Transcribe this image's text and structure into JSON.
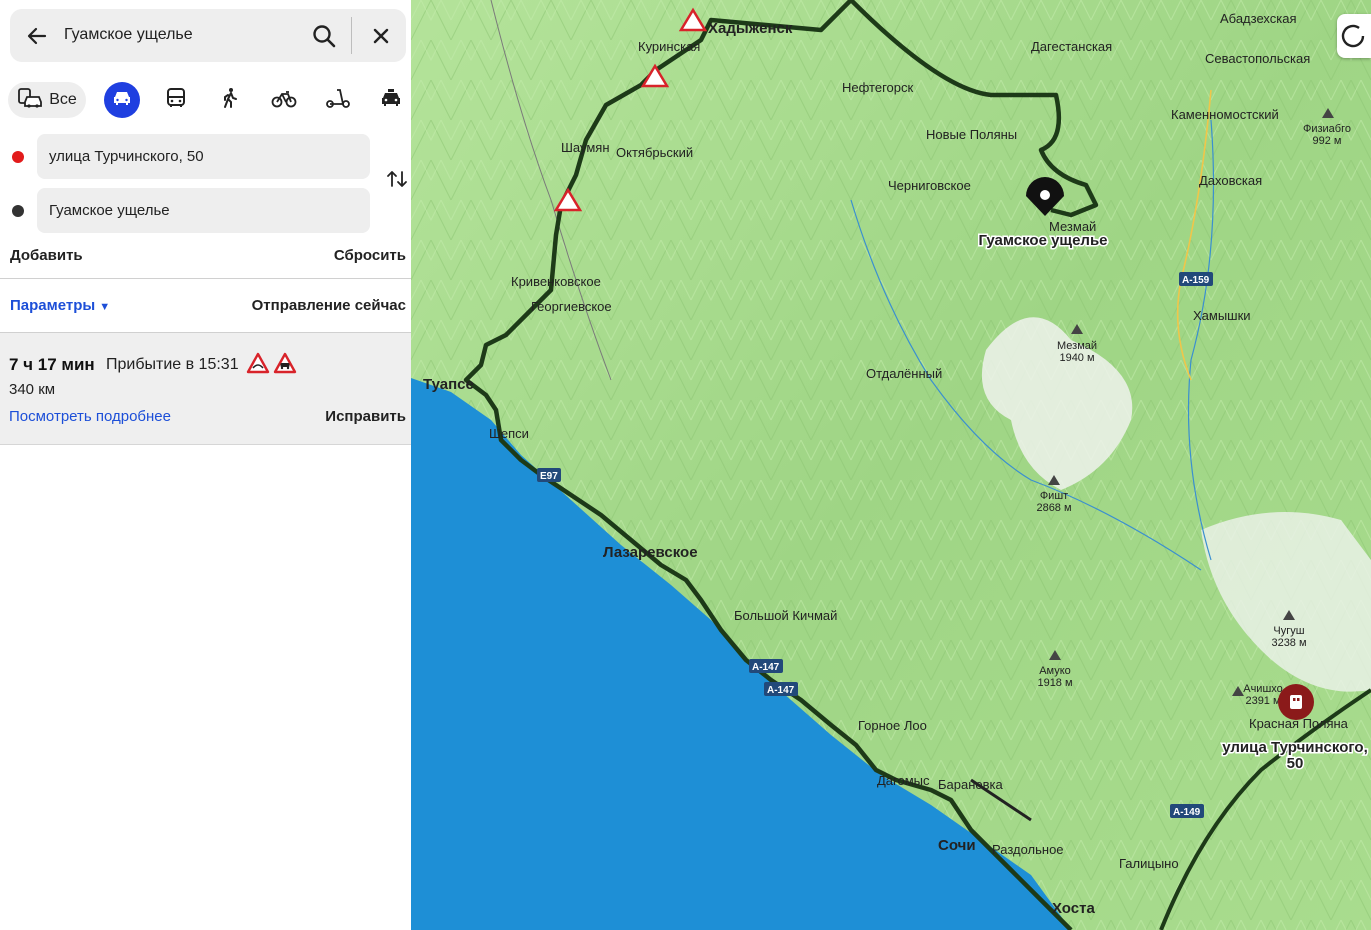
{
  "search": {
    "query": "Гуамское ущелье",
    "back_icon": "arrow-left-icon",
    "search_icon": "search-icon",
    "close_icon": "close-icon"
  },
  "modes": {
    "all_label": "Все",
    "selected": "car",
    "icons": [
      "mixed-transport-icon",
      "car-icon",
      "bus-icon",
      "walk-icon",
      "bicycle-icon",
      "scooter-icon",
      "taxi-icon"
    ]
  },
  "route": {
    "from": "улица Турчинского, 50",
    "to": "Гуамское ущелье",
    "add_label": "Добавить",
    "reset_label": "Сбросить",
    "params_label": "Параметры",
    "depart_label": "Отправление сейчас",
    "time": "7 ч 17 мин",
    "arrival": "Прибытие в 15:31",
    "distance": "340 км",
    "details_label": "Посмотреть подробнее",
    "fix_label": "Исправить"
  },
  "colors": {
    "accent_blue": "#1f3fe0",
    "link_blue": "#1d4fd8",
    "from_dot": "#e21b1b",
    "route_line": "#1d3a18",
    "sea": "#1e8fd6",
    "land": "#a6d98a"
  },
  "map": {
    "cities": [
      {
        "name": "Хадыженск",
        "big": true
      },
      {
        "name": "Куринская"
      },
      {
        "name": "Нефтегорск"
      },
      {
        "name": "Дагестанская"
      },
      {
        "name": "Абадзехская"
      },
      {
        "name": "Севастопольская"
      },
      {
        "name": "Каменномостский"
      },
      {
        "name": "Даховская"
      },
      {
        "name": "Новые Поляны"
      },
      {
        "name": "Черниговское"
      },
      {
        "name": "Мезмай"
      },
      {
        "name": "Шаумян"
      },
      {
        "name": "Октябрьский"
      },
      {
        "name": "Кривенковское"
      },
      {
        "name": "Георгиевское"
      },
      {
        "name": "Хамышки"
      },
      {
        "name": "Отдалённый"
      },
      {
        "name": "Туапсе",
        "big": true
      },
      {
        "name": "Шепси"
      },
      {
        "name": "Лазаревское",
        "big": true
      },
      {
        "name": "Большой Кичмай"
      },
      {
        "name": "Горное Лоо"
      },
      {
        "name": "Дагомыс"
      },
      {
        "name": "Барановка"
      },
      {
        "name": "Сочи",
        "big": true
      },
      {
        "name": "Раздольное"
      },
      {
        "name": "Галицыно"
      },
      {
        "name": "Хоста",
        "big": true
      },
      {
        "name": "Красная Поляна"
      }
    ],
    "peaks": [
      {
        "name": "Физиабго",
        "elev": "992 м"
      },
      {
        "name": "Мезмай",
        "elev": "1940 м"
      },
      {
        "name": "Фишт",
        "elev": "2868 м"
      },
      {
        "name": "Чугуш",
        "elev": "3238 м"
      },
      {
        "name": "Амуко",
        "elev": "1918 м"
      },
      {
        "name": "Ачишхо",
        "elev": "2391 м"
      }
    ],
    "roads": [
      "А-159",
      "Е97",
      "А-147",
      "А-147",
      "А-149"
    ],
    "pin_destination": "Гуамское ущелье",
    "pin_origin_line1": "улица Турчинского,",
    "pin_origin_line2": "50"
  }
}
